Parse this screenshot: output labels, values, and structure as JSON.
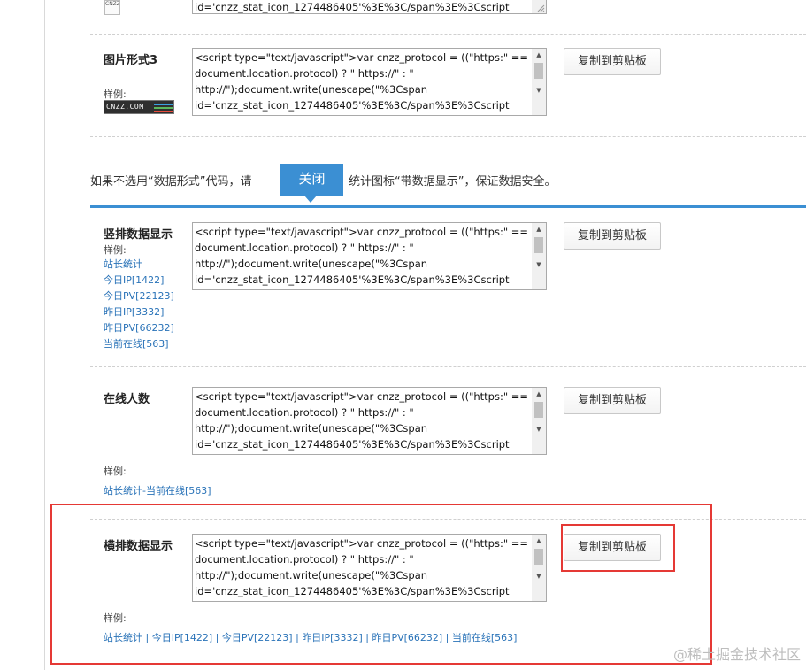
{
  "code_snippet": "<script type=\"text/javascript\">var cnzz_protocol = ((\"https:\" ==\ndocument.location.protocol) ? \" https://\" : \"\nhttp://\");document.write(unescape(\"%3Cspan\nid='cnzz_stat_icon_1274486405'%3E%3C/span%3E%3Cscript",
  "top_partial_code": "id='cnzz_stat_icon_1274486405'%3E%3C/span%3E%3Cscript",
  "copy_label": "复制到剪贴板",
  "sample_label": "样例:",
  "logo_small_text": "CNZZ",
  "logo_wide_text": "CNZZ.COM",
  "section_image3": {
    "title": "图片形式3"
  },
  "notice": {
    "before": "如果不选用“数据形式”代码，请",
    "close_label": "关闭",
    "after": "统计图标“带数据显示”，保证数据安全。"
  },
  "section_vertical": {
    "title": "竖排数据显示",
    "links": [
      "站长统计",
      "今日IP[1422]",
      "今日PV[22123]",
      "昨日IP[3332]",
      "昨日PV[66232]",
      "当前在线[563]"
    ]
  },
  "section_online": {
    "title": "在线人数",
    "link": "站长统计-当前在线[563]"
  },
  "section_horizontal": {
    "title": "横排数据显示",
    "links_text": "站长统计 | 今日IP[1422] | 今日PV[22123] | 昨日IP[3332] | 昨日PV[66232] | 当前在线[563]"
  },
  "watermark": "@稀土掘金技术社区",
  "colors": {
    "accent": "#3b8fd3",
    "highlight": "#e53935",
    "link": "#2a73b8"
  }
}
